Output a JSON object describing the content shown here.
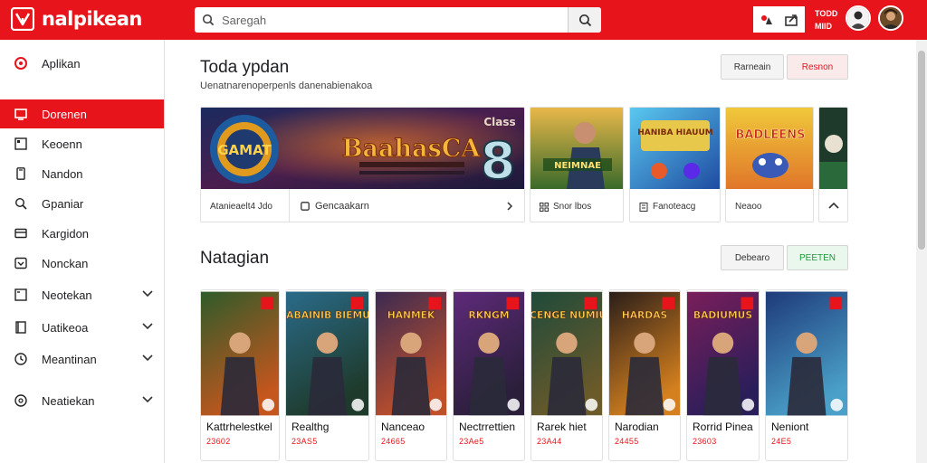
{
  "header": {
    "app_name": "nalpikean",
    "search_placeholder": "Saregah",
    "side_text_line1": "TODD",
    "side_text_line2": "MIID"
  },
  "sidebar": {
    "top_item": "Aplikan",
    "items": [
      {
        "label": "Dorenen",
        "icon": "tv-icon",
        "active": true
      },
      {
        "label": "Keoenn",
        "icon": "window-icon"
      },
      {
        "label": "Nandon",
        "icon": "phone-icon"
      },
      {
        "label": "Gpaniar",
        "icon": "search-icon"
      },
      {
        "label": "Kargidon",
        "icon": "card-icon"
      },
      {
        "label": "Nonckan",
        "icon": "monitor-icon"
      },
      {
        "label": "Neotekan",
        "icon": "square-icon",
        "chevron": true
      },
      {
        "label": "Uatikeoa",
        "icon": "book-icon",
        "chevron": true
      },
      {
        "label": "Meantinan",
        "icon": "clock-icon",
        "chevron": true
      },
      {
        "label": "Neatiekan",
        "icon": "globe-icon",
        "chevron": true
      }
    ]
  },
  "section1": {
    "title": "Toda ypdan",
    "subtitle": "Uenatnarenoperpenls danenabienakoa",
    "button_left": "Rarneain",
    "button_right": "Resnon",
    "banner_title": "BaahasCA",
    "banner_logo": "GAMAT",
    "banner_badge": "Class",
    "banner_number": "8",
    "banner_caption": "Atanieaelt4 Jdo",
    "banner_link": "Gencaakarn",
    "tiles": [
      {
        "art_title": "NEIMNAE",
        "label": "Snor lbos"
      },
      {
        "art_title": "HANIBA HIAUUM",
        "label": "Fanoteacg"
      },
      {
        "art_title": "BADLEENS",
        "label": "Neaoo"
      }
    ]
  },
  "section2": {
    "title": "Natagian",
    "button_left": "Debearo",
    "button_right": "PEETEN",
    "games": [
      {
        "name": "Kattrhelestkel",
        "rating": "23602",
        "art_title": "",
        "bg1": "#2e5b2a",
        "bg2": "#c4561e"
      },
      {
        "name": "Realthg",
        "rating": "23AS5",
        "art_title": "SIBABAINIB BIEMUNG",
        "bg1": "#2a6b8a",
        "bg2": "#1e3a2a"
      },
      {
        "name": "Nanceao",
        "rating": "24665",
        "art_title": "HANMEK",
        "bg1": "#3b2a52",
        "bg2": "#c0502a"
      },
      {
        "name": "Nectrrettien",
        "rating": "23Ae5",
        "art_title": "RKNGM",
        "bg1": "#5e2a7a",
        "bg2": "#2a1e3a"
      },
      {
        "name": "Rarek hiet",
        "rating": "23A44",
        "art_title": "SICENGE NUMIUK",
        "bg1": "#1e4a3a",
        "bg2": "#6b5a2a"
      },
      {
        "name": "Narodian",
        "rating": "24455",
        "art_title": "HARDAS",
        "bg1": "#2a1e1a",
        "bg2": "#d4801e"
      },
      {
        "name": "Rorrid Pinea",
        "rating": "23603",
        "art_title": "BADIUMUS",
        "bg1": "#7a1e5a",
        "bg2": "#2a1e5a"
      },
      {
        "name": "Neniont",
        "rating": "24E5",
        "art_title": "",
        "bg1": "#1e3a7a",
        "bg2": "#4aa0c8"
      }
    ]
  },
  "colors": {
    "brand_red": "#e8141b",
    "accent_green": "#1e9a3a"
  }
}
